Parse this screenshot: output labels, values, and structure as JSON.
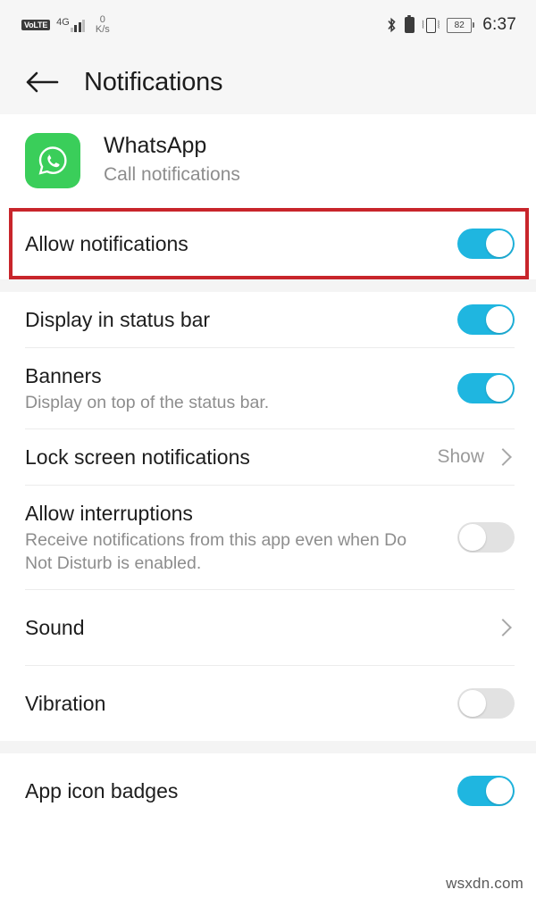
{
  "status_bar": {
    "volte_label": "VoLTE",
    "network_generation": "4G",
    "data_rate_value": "0",
    "data_rate_unit": "K/s",
    "bluetooth_icon": "bluetooth-icon",
    "battery_icon": "battery-solid-icon",
    "vibrate_icon": "vibrate-icon",
    "battery_percent": "82",
    "time": "6:37"
  },
  "appbar": {
    "back_icon": "back-arrow-icon",
    "title": "Notifications"
  },
  "app_header": {
    "icon_name": "whatsapp-icon",
    "icon_color": "#3ace5a",
    "name": "WhatsApp",
    "subtitle": "Call notifications"
  },
  "highlight": {
    "color": "#c8252b"
  },
  "settings": {
    "accent_on_color": "#1fb6e0",
    "off_color": "#e2e2e2",
    "sections": [
      {
        "rows": [
          {
            "title": "Allow notifications",
            "subtitle": "",
            "control": "toggle",
            "state": "on",
            "value": "",
            "highlighted": true
          }
        ]
      },
      {
        "rows": [
          {
            "title": "Display in status bar",
            "subtitle": "",
            "control": "toggle",
            "state": "on",
            "value": "",
            "highlighted": false
          },
          {
            "title": "Banners",
            "subtitle": "Display on top of the status bar.",
            "control": "toggle",
            "state": "on",
            "value": "",
            "highlighted": false
          },
          {
            "title": "Lock screen notifications",
            "subtitle": "",
            "control": "value-chevron",
            "state": "",
            "value": "Show",
            "highlighted": false
          },
          {
            "title": "Allow interruptions",
            "subtitle": "Receive notifications from this app even when Do Not Disturb is enabled.",
            "control": "toggle",
            "state": "off",
            "value": "",
            "highlighted": false
          },
          {
            "title": "Sound",
            "subtitle": "",
            "control": "chevron",
            "state": "",
            "value": "",
            "highlighted": false
          },
          {
            "title": "Vibration",
            "subtitle": "",
            "control": "toggle",
            "state": "off",
            "value": "",
            "highlighted": false
          }
        ]
      },
      {
        "rows": [
          {
            "title": "App icon badges",
            "subtitle": "",
            "control": "toggle",
            "state": "on",
            "value": "",
            "highlighted": false
          }
        ]
      }
    ]
  },
  "watermark": "wsxdn.com"
}
